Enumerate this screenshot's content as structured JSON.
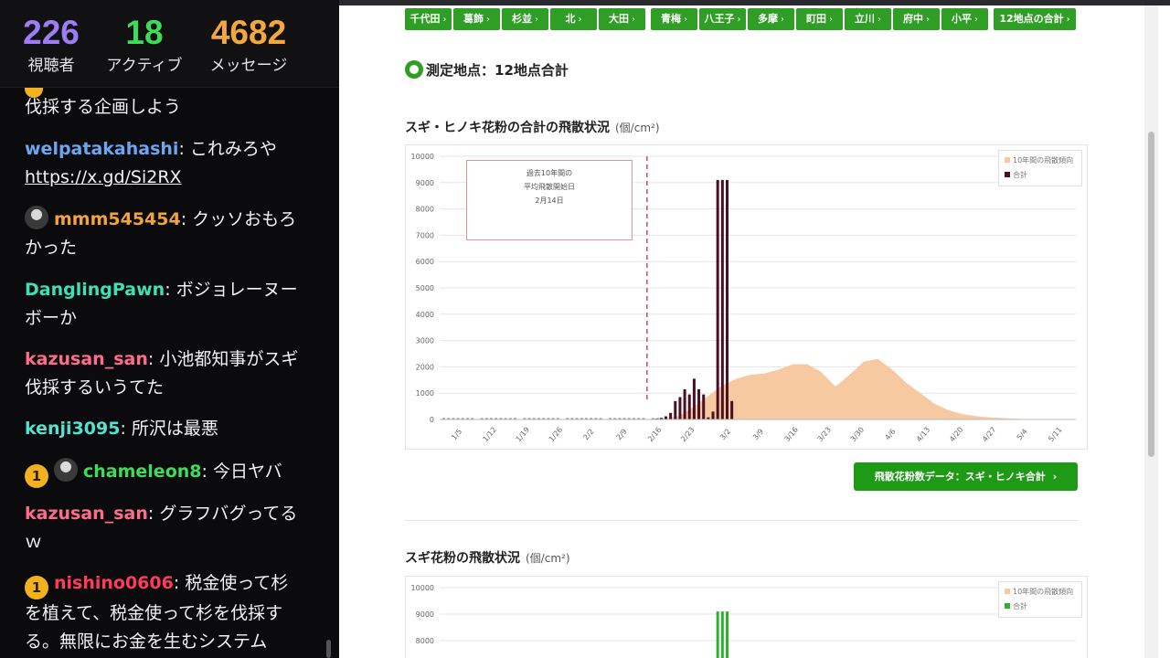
{
  "stream": {
    "stats": [
      {
        "value": "226",
        "label": "視聴者",
        "color": "#9e7cf6"
      },
      {
        "value": "18",
        "label": "アクティブ",
        "color": "#3ddc59"
      },
      {
        "value": "4682",
        "label": "メッセージ",
        "color": "#f2a83b"
      }
    ],
    "messages": [
      {
        "user": "",
        "text": "伐採する企画しよう",
        "badge": "",
        "avatar": false,
        "user_color": "#ffffff"
      },
      {
        "user": "welpatakahashi",
        "text": "これみろや",
        "link": "https://x.gd/Si2RX",
        "badge": "",
        "avatar": false,
        "user_color": "#6aa7f0"
      },
      {
        "user": "mmm545454",
        "text": "クッソおもろかった",
        "badge": "",
        "avatar": true,
        "user_color": "#f2a33b"
      },
      {
        "user": "DanglingPawn",
        "text": "ボジョレーヌーボーか",
        "badge": "",
        "avatar": false,
        "user_color": "#3fe0b4"
      },
      {
        "user": "kazusan_san",
        "text": "小池都知事がスギ伐採するいうてた",
        "badge": "",
        "avatar": false,
        "user_color": "#ff6b8b"
      },
      {
        "user": "kenji3095",
        "text": "所沢は最悪",
        "badge": "",
        "avatar": false,
        "user_color": "#56e0d0"
      },
      {
        "user": "chameleon8",
        "text": "今日ヤバ",
        "badge": "1",
        "avatar": true,
        "user_color": "#3ddc59"
      },
      {
        "user": "kazusan_san",
        "text": "グラフバグってるｗ",
        "badge": "",
        "avatar": false,
        "user_color": "#ff6b8b"
      },
      {
        "user": "nishino0606",
        "text": "税金使って杉を植えて、税金使って杉を伐採する。無限にお金を生むシステム",
        "badge": "1",
        "avatar": false,
        "user_color": "#ff3b5c"
      }
    ]
  },
  "page": {
    "tabs": [
      "千代田",
      "葛飾",
      "杉並",
      "北",
      "大田",
      "青梅",
      "八王子",
      "多摩",
      "町田",
      "立川",
      "府中",
      "小平",
      "12地点の合計"
    ],
    "location": "測定地点：12地点合計",
    "chart1_title": "スギ・ヒノキ花粉の合計の飛散状況",
    "chart2_title": "スギ花粉の飛散状況",
    "unit": "(個/cm²)",
    "annotation": [
      "過去10年間の",
      "平均飛散開始日",
      "2月14日"
    ],
    "data_button": "飛散花粉数データ：スギ・ヒノキ合計",
    "legend_avg": "10年間の飛散傾向",
    "legend_total": "合計",
    "colors": {
      "accent": "#2f9e24",
      "bar": "#4a0f22",
      "avg": "#f7c9a0",
      "bar2": "#2fb12f",
      "marker": "#c8313c"
    }
  },
  "chart_data": [
    {
      "type": "bar",
      "title": "スギ・ヒノキ花粉の合計の飛散状況",
      "ylabel": "(個/cm²)",
      "ylim": [
        0,
        10000
      ],
      "yticks": [
        0,
        1000,
        2000,
        3000,
        4000,
        5000,
        6000,
        7000,
        8000,
        9000,
        10000
      ],
      "xticks": [
        "1/5",
        "1/12",
        "1/19",
        "1/26",
        "2/2",
        "2/9",
        "2/16",
        "2/23",
        "3/2",
        "3/9",
        "3/16",
        "3/23",
        "3/30",
        "4/6",
        "4/13",
        "4/20",
        "4/27",
        "5/4",
        "5/11"
      ],
      "x_start": "1/1",
      "x_end": "5/15",
      "legend": "top-right",
      "grid": true,
      "vline": {
        "date": "2/14",
        "label": "過去10年間の 平均飛散開始日 2月14日"
      },
      "series": [
        {
          "name": "10年間の飛散傾向",
          "type": "area",
          "x": [
            "2/17",
            "2/21",
            "2/24",
            "2/27",
            "3/1",
            "3/4",
            "3/7",
            "3/10",
            "3/13",
            "3/16",
            "3/19",
            "3/22",
            "3/25",
            "3/28",
            "3/31",
            "4/3",
            "4/6",
            "4/9",
            "4/12",
            "4/15",
            "4/18",
            "4/21",
            "4/24",
            "4/27",
            "4/30",
            "5/3",
            "5/6"
          ],
          "values": [
            0,
            150,
            500,
            900,
            1300,
            1550,
            1700,
            1750,
            1900,
            2100,
            2100,
            1800,
            1250,
            1700,
            2200,
            2300,
            1900,
            1400,
            1000,
            600,
            350,
            200,
            120,
            80,
            50,
            25,
            0
          ]
        },
        {
          "name": "合計",
          "type": "bar",
          "x": [
            "2/16",
            "2/17",
            "2/18",
            "2/19",
            "2/20",
            "2/21",
            "2/22",
            "2/23",
            "2/24",
            "2/25",
            "2/26",
            "2/27",
            "2/28",
            "2/29",
            "3/1",
            "3/2",
            "3/3"
          ],
          "values": [
            30,
            60,
            120,
            250,
            700,
            850,
            1150,
            950,
            1550,
            1150,
            950,
            80,
            300,
            9100,
            9100,
            9100,
            700
          ]
        }
      ]
    },
    {
      "type": "bar",
      "title": "スギ花粉の飛散状況",
      "ylabel": "(個/cm²)",
      "ylim": [
        0,
        10000
      ],
      "yticks": [
        8000,
        9000,
        10000
      ],
      "legend": "top-right",
      "grid": true,
      "series": [
        {
          "name": "10年間の飛散傾向",
          "type": "area",
          "x": [],
          "values": []
        },
        {
          "name": "合計",
          "type": "bar",
          "x": [
            "2/29",
            "3/1",
            "3/2"
          ],
          "values": [
            9100,
            9100,
            9100
          ]
        }
      ]
    }
  ]
}
